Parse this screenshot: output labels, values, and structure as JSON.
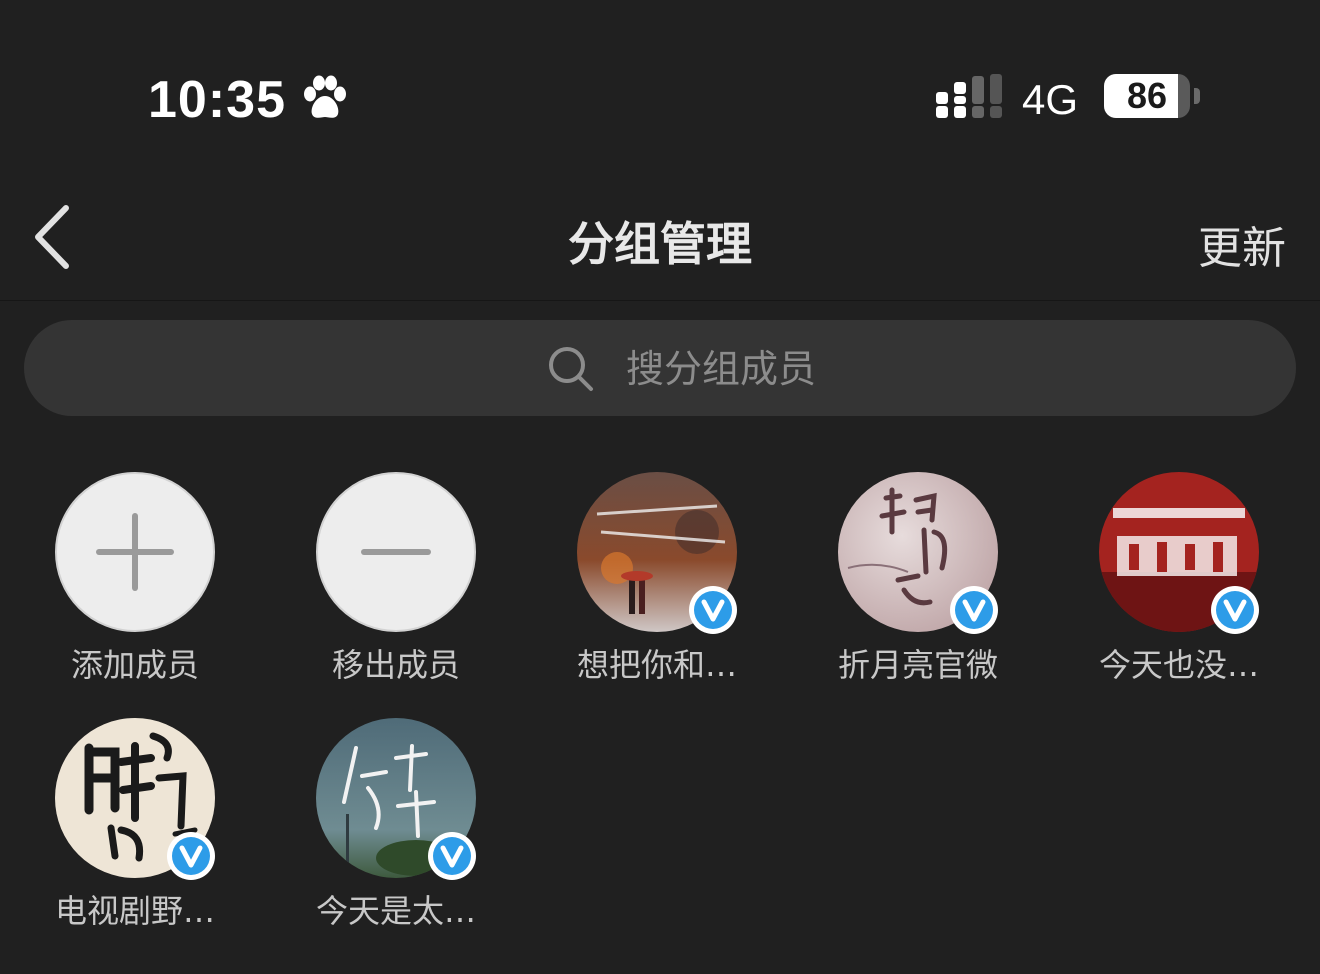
{
  "status_bar": {
    "time": "10:35",
    "network": "4G",
    "battery": 86
  },
  "nav": {
    "title": "分组管理",
    "right_action": "更新"
  },
  "search": {
    "placeholder": "搜分组成员"
  },
  "actions": [
    {
      "label": "添加成员",
      "icon": "plus-icon"
    },
    {
      "label": "移出成员",
      "icon": "minus-icon"
    }
  ],
  "members": [
    {
      "label": "想把你和…",
      "verified": true
    },
    {
      "label": "折月亮官微",
      "verified": true
    },
    {
      "label": "今天也没…",
      "verified": true
    },
    {
      "label": "电视剧野…",
      "verified": true
    },
    {
      "label": "今天是太…",
      "verified": true
    }
  ],
  "colors": {
    "background": "#202020",
    "search_background": "#343434",
    "verified_badge": "#2d9ce8"
  }
}
